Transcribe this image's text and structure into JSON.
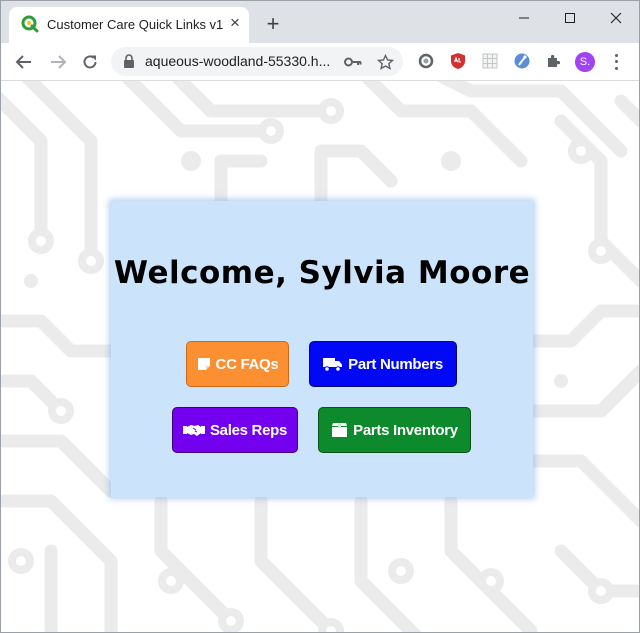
{
  "browser": {
    "tab_title": "Customer Care Quick Links v1",
    "tab_close": "×",
    "new_tab": "+",
    "url": "aqueous-woodland-55330.h...",
    "profile_initial": "S."
  },
  "page": {
    "welcome": "Welcome, Sylvia Moore",
    "buttons": [
      {
        "label": "CC FAQs",
        "icon": "sticky-note-icon",
        "color": "#fc8f32"
      },
      {
        "label": "Part Numbers",
        "icon": "truck-icon",
        "color": "#0008f5"
      },
      {
        "label": "Sales Reps",
        "icon": "handshake-icon",
        "color": "#7400f0"
      },
      {
        "label": "Parts Inventory",
        "icon": "box-icon",
        "color": "#0c8a2c"
      }
    ]
  },
  "colors": {
    "card_bg": "#cce4fb",
    "tab_strip": "#dee1e6",
    "profile": "#a142f4"
  }
}
